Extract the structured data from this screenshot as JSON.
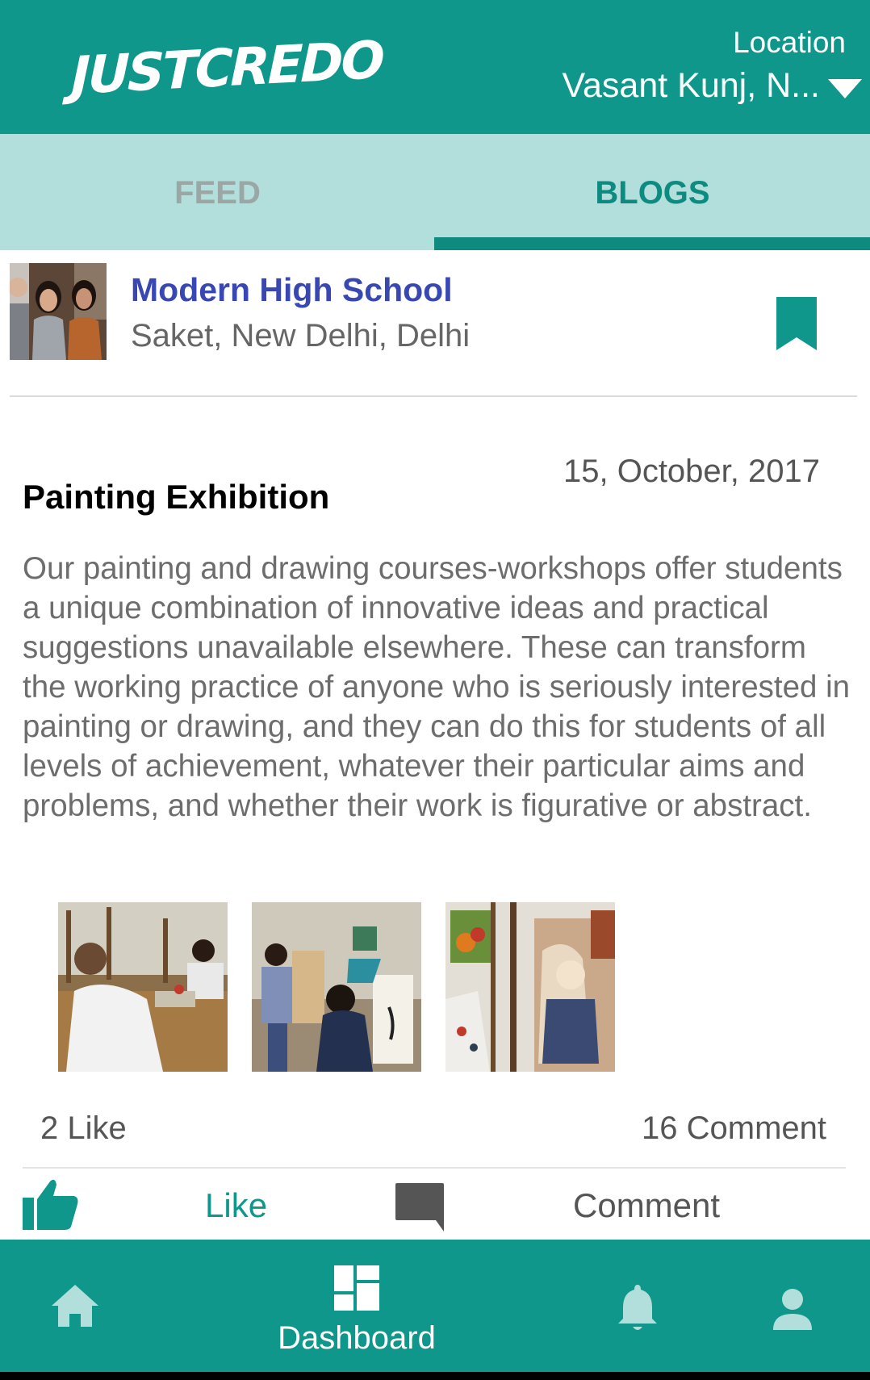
{
  "header": {
    "brand": "JUSTCREDO",
    "location_label": "Location",
    "location_value": "Vasant Kunj, N..."
  },
  "tabs": [
    {
      "label": "FEED",
      "active": false
    },
    {
      "label": "BLOGS",
      "active": true
    }
  ],
  "school": {
    "name": "Modern High School",
    "address": "Saket, New Delhi, Delhi"
  },
  "post": {
    "date": "15, October, 2017",
    "title": "Painting Exhibition",
    "body": "Our painting and drawing courses-workshops offer students a unique combination of innovative ideas and practical suggestions unavailable elsewhere. These can transform the working practice of anyone who is seriously interested in painting or drawing, and they can do this for students of all levels of achievement, whatever their particular aims and problems, and whether their work is figurative or abstract.",
    "like_count": "2  Like",
    "comment_count": "16  Comment"
  },
  "actions": {
    "like_label": "Like",
    "comment_label": "Comment"
  },
  "bottom_nav": {
    "dashboard_label": "Dashboard"
  },
  "colors": {
    "primary": "#0e978a",
    "tab_bg": "#b2dfdb",
    "school_name": "#3947b3"
  },
  "icons": [
    "home-icon",
    "dashboard-icon",
    "bell-icon",
    "profile-icon",
    "thumbs-up-icon",
    "comment-icon",
    "bookmark-icon",
    "caret-down-icon"
  ]
}
